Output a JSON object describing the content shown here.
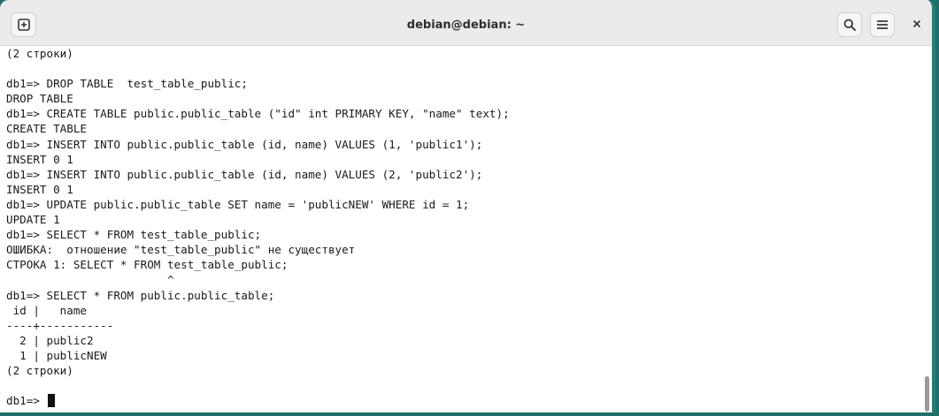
{
  "window": {
    "title": "debian@debian: ~"
  },
  "icons": {
    "new_tab": "new-tab-icon",
    "search": "search-icon",
    "menu": "hamburger-menu-icon",
    "close": "close-icon"
  },
  "terminal": {
    "lines": [
      "(2 строки)",
      "",
      "db1=> DROP TABLE  test_table_public;",
      "DROP TABLE",
      "db1=> CREATE TABLE public.public_table (\"id\" int PRIMARY KEY, \"name\" text);",
      "CREATE TABLE",
      "db1=> INSERT INTO public.public_table (id, name) VALUES (1, 'public1');",
      "INSERT 0 1",
      "db1=> INSERT INTO public.public_table (id, name) VALUES (2, 'public2');",
      "INSERT 0 1",
      "db1=> UPDATE public.public_table SET name = 'publicNEW' WHERE id = 1;",
      "UPDATE 1",
      "db1=> SELECT * FROM test_table_public;",
      "ОШИБКА:  отношение \"test_table_public\" не существует",
      "СТРОКА 1: SELECT * FROM test_table_public;",
      "                        ^",
      "db1=> SELECT * FROM public.public_table;",
      " id |   name",
      "----+-----------",
      "  2 | public2",
      "  1 | publicNEW",
      "(2 строки)",
      ""
    ],
    "prompt": "db1=> "
  }
}
